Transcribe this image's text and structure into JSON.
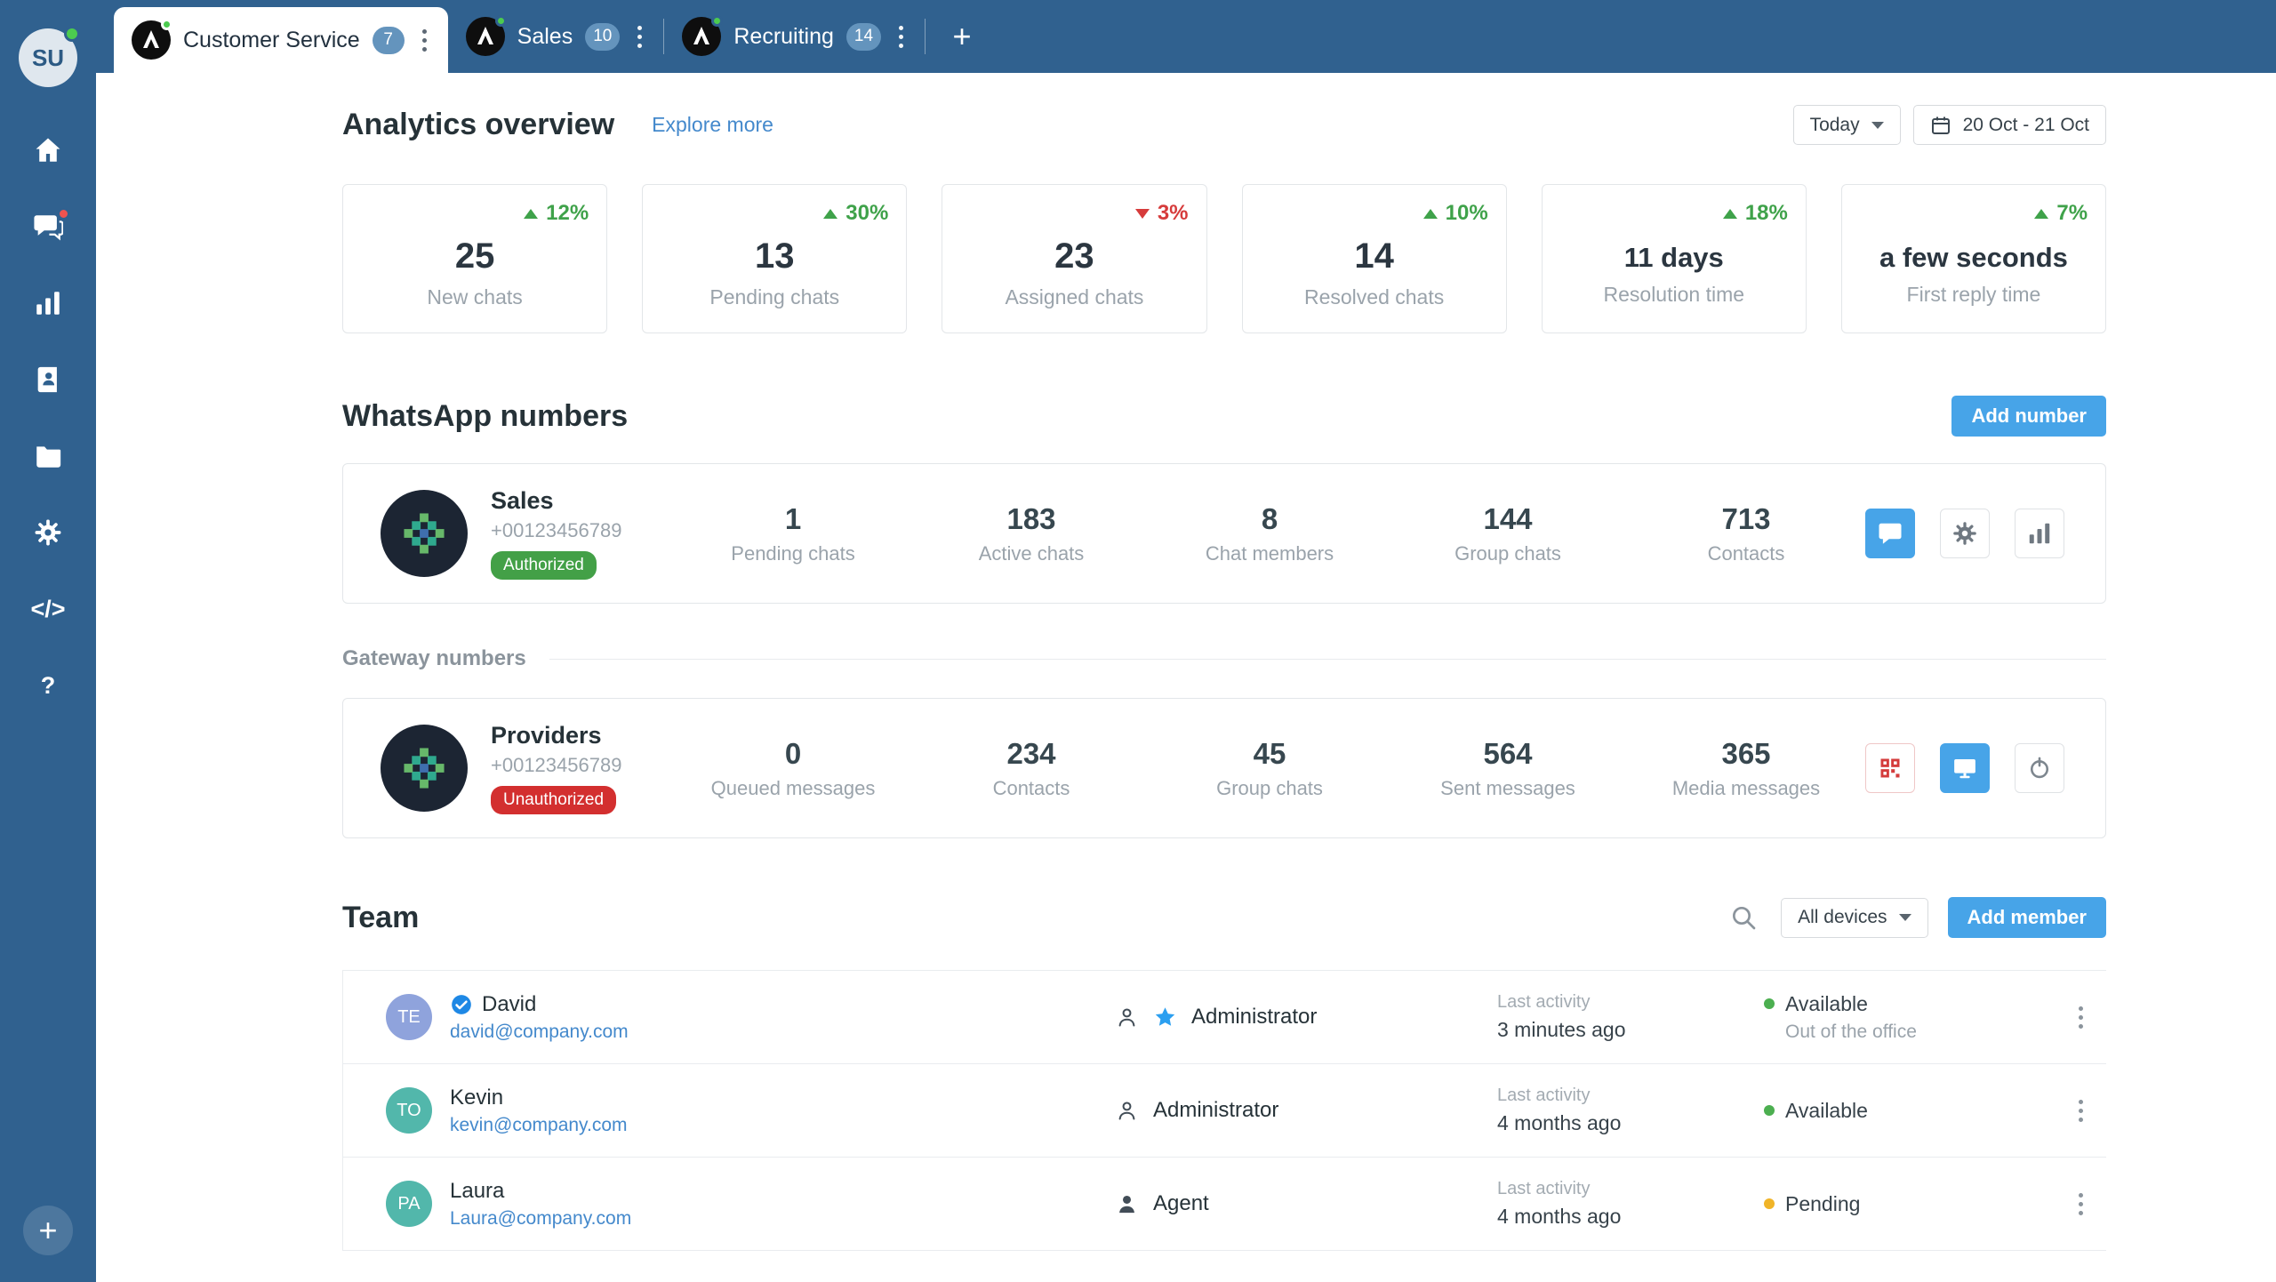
{
  "topbar": {
    "tabs": [
      {
        "label": "Customer Service",
        "badge": "7"
      },
      {
        "label": "Sales",
        "badge": "10"
      },
      {
        "label": "Recruiting",
        "badge": "14"
      }
    ]
  },
  "sidebar": {
    "avatar_initials": "SU"
  },
  "icons": {
    "code": "</>",
    "help": "?",
    "plus": "+"
  },
  "analytics": {
    "title": "Analytics overview",
    "explore_link": "Explore more",
    "period_button": "Today",
    "date_range": "20 Oct - 21 Oct",
    "cards": [
      {
        "delta": "12%",
        "direction": "up",
        "value": "25",
        "label": "New chats"
      },
      {
        "delta": "30%",
        "direction": "up",
        "value": "13",
        "label": "Pending chats"
      },
      {
        "delta": "3%",
        "direction": "down",
        "value": "23",
        "label": "Assigned chats"
      },
      {
        "delta": "10%",
        "direction": "up",
        "value": "14",
        "label": "Resolved chats"
      },
      {
        "delta": "18%",
        "direction": "up",
        "value": "11 days",
        "label": "Resolution time"
      },
      {
        "delta": "7%",
        "direction": "up",
        "value": "a few seconds",
        "label": "First reply time"
      }
    ]
  },
  "whatsapp": {
    "title": "WhatsApp numbers",
    "add_button": "Add number",
    "number": {
      "name": "Sales",
      "phone": "+00123456789",
      "status_badge": "Authorized",
      "stats": [
        {
          "value": "1",
          "label": "Pending chats"
        },
        {
          "value": "183",
          "label": "Active chats"
        },
        {
          "value": "8",
          "label": "Chat members"
        },
        {
          "value": "144",
          "label": "Group chats"
        },
        {
          "value": "713",
          "label": "Contacts"
        }
      ]
    },
    "gateway_heading": "Gateway numbers",
    "gateway": {
      "name": "Providers",
      "phone": "+00123456789",
      "status_badge": "Unauthorized",
      "stats": [
        {
          "value": "0",
          "label": "Queued messages"
        },
        {
          "value": "234",
          "label": "Contacts"
        },
        {
          "value": "45",
          "label": "Group chats"
        },
        {
          "value": "564",
          "label": "Sent messages"
        },
        {
          "value": "365",
          "label": "Media messages"
        }
      ]
    }
  },
  "team": {
    "title": "Team",
    "device_filter": "All devices",
    "add_button": "Add member",
    "activity_label": "Last activity",
    "members": [
      {
        "initials": "TE",
        "name": "David",
        "email": "david@company.com",
        "role": "Administrator",
        "activity": "3 minutes ago",
        "status": "Available",
        "status_note": "Out of the office"
      },
      {
        "initials": "TO",
        "name": "Kevin",
        "email": "kevin@company.com",
        "role": "Administrator",
        "activity": "4 months ago",
        "status": "Available"
      },
      {
        "initials": "PA",
        "name": "Laura",
        "email": "Laura@company.com",
        "role": "Agent",
        "activity": "4 months ago",
        "status": "Pending"
      }
    ]
  },
  "colors": {
    "topbar": "#30618F",
    "accent_blue": "#47A4E8",
    "green": "#43A047",
    "red": "#D32F2F",
    "link": "#4489CC",
    "status_available": "#4CAF50",
    "status_pending": "#F0B428"
  }
}
